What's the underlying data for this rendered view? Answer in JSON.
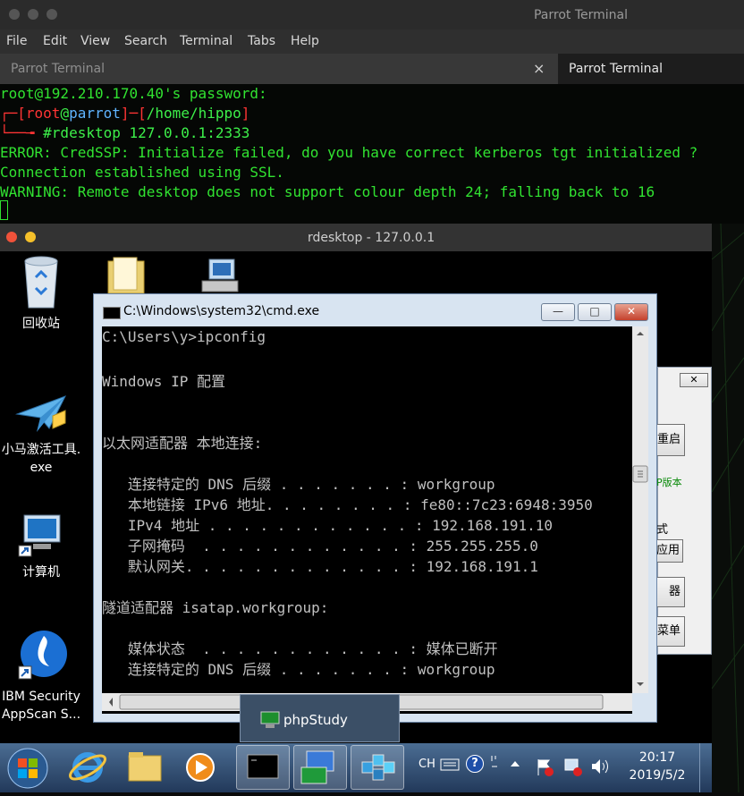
{
  "terminal": {
    "window_title": "Parrot Terminal",
    "menu": [
      "File",
      "Edit",
      "View",
      "Search",
      "Terminal",
      "Tabs",
      "Help"
    ],
    "tabs": [
      {
        "label": "Parrot Terminal",
        "close": "×"
      },
      {
        "label": "Parrot Terminal"
      }
    ],
    "lines": {
      "password": "root@192.210.170.40's password:",
      "prompt_corner": "┌─",
      "prompt_open": "[",
      "prompt_user": "root",
      "prompt_at": "@",
      "prompt_host": "parrot",
      "prompt_mid": "]─[",
      "prompt_path": "/home/hippo",
      "prompt_close": "]",
      "prompt2_corner": "└──╼",
      "prompt2_hash": " #",
      "command": "rdesktop 127.0.0.1:2333",
      "error": "ERROR: CredSSP: Initialize failed, do you have correct kerberos tgt initialized ?",
      "connection": "Connection established using SSL.",
      "warning": "WARNING: Remote desktop does not support colour depth 24; falling back to 16"
    }
  },
  "rdesktop": {
    "title": "rdesktop - 127.0.0.1"
  },
  "desktop": {
    "icons": [
      {
        "name": "recycle-bin",
        "label": "回收站"
      },
      {
        "name": "folder",
        "label": ""
      },
      {
        "name": "network",
        "label": ""
      },
      {
        "name": "activator",
        "label": "小马激活工具.\nexe"
      },
      {
        "name": "computer",
        "label": "计算机"
      },
      {
        "name": "appscan",
        "label": "IBM Security\nAppScan S..."
      }
    ]
  },
  "cmd": {
    "title": "C:\\Windows\\system32\\cmd.exe",
    "buttons": {
      "minimize": "—",
      "maximize": "□",
      "close": "✕"
    },
    "lines": [
      "C:\\Users\\y>ipconfig",
      "",
      "Windows IP 配置",
      "",
      "",
      "以太网适配器 本地连接:",
      "",
      "   连接特定的 DNS 后缀 . . . . . . . : workgroup",
      "   本地链接 IPv6 地址. . . . . . . . : fe80::7c23:6948:3950",
      "   IPv4 地址 . . . . . . . . . . . . : 192.168.191.10",
      "   子网掩码  . . . . . . . . . . . . : 255.255.255.0",
      "   默认网关. . . . . . . . . . . . . : 192.168.191.1",
      "",
      "隧道适配器 isatap.workgroup:",
      "",
      "   媒体状态  . . . . . . . . . . . . : 媒体已断开",
      "   连接特定的 DNS 后缀 . . . . . . . : workgroup"
    ]
  },
  "background_dialog": {
    "close": "✕",
    "btn_restart": "重启",
    "group_label": "P版本",
    "text_shi": "式",
    "btn_apply": "应用",
    "btn_qi": "器",
    "btn_menu": "菜单"
  },
  "phpstudy_popup": {
    "label": "phpStudy"
  },
  "taskbar": {
    "items": [
      "start",
      "ie",
      "explorer",
      "media-player",
      "cmd",
      "network-tool",
      "registry-tool"
    ],
    "tray": {
      "lang": "CH",
      "help": "?"
    },
    "time": "20:17",
    "date": "2019/5/2"
  }
}
